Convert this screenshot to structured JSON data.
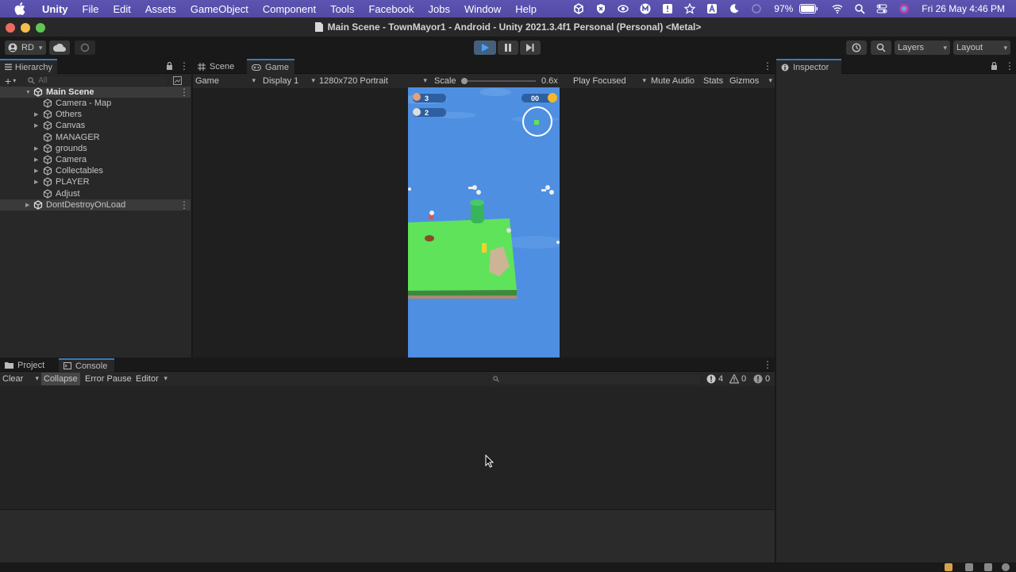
{
  "menubar": {
    "app": "Unity",
    "items": [
      "File",
      "Edit",
      "Assets",
      "GameObject",
      "Component",
      "Tools",
      "Facebook",
      "Jobs",
      "Window",
      "Help"
    ],
    "battery": "97%",
    "datetime": "Fri 26 May  4:46 PM",
    "status_icons": [
      "unity-icon",
      "x-shield-icon",
      "eye-icon",
      "m-icon",
      "alert-icon",
      "star-icon",
      "a-icon",
      "moon-icon",
      "wifi-dim-icon",
      "battery-icon",
      "wifi-icon",
      "search-icon",
      "control-center-icon",
      "siri-icon"
    ]
  },
  "window": {
    "title": "Main Scene - TownMayor1 - Android - Unity 2021.3.4f1 Personal (Personal) <Metal>"
  },
  "toolbar": {
    "account": "RD",
    "layers": "Layers",
    "layout": "Layout"
  },
  "hierarchy": {
    "tab": "Hierarchy",
    "search_placeholder": "All",
    "scene": "Main Scene",
    "items": [
      {
        "label": "Camera - Map",
        "arrow": false
      },
      {
        "label": "Others",
        "arrow": true
      },
      {
        "label": "Canvas",
        "arrow": true
      },
      {
        "label": "MANAGER",
        "arrow": false
      },
      {
        "label": "grounds",
        "arrow": true
      },
      {
        "label": "Camera",
        "arrow": true
      },
      {
        "label": "Collectables",
        "arrow": true
      },
      {
        "label": "PLAYER",
        "arrow": true
      },
      {
        "label": "Adjust",
        "arrow": false
      }
    ],
    "dontdestroy": "DontDestroyOnLoad"
  },
  "game_view": {
    "tabs": [
      "Scene",
      "Game"
    ],
    "mode": "Game",
    "display": "Display 1",
    "resolution": "1280x720 Portrait",
    "scale_label": "Scale",
    "scale_value": "0.6x",
    "play_focused": "Play Focused",
    "mute_audio": "Mute Audio",
    "stats": "Stats",
    "gizmos": "Gizmos",
    "hud": {
      "wood": "3",
      "stone": "2",
      "coins": "00"
    }
  },
  "inspector": {
    "tab": "Inspector"
  },
  "console": {
    "tabs": [
      "Project",
      "Console"
    ],
    "clear": "Clear",
    "collapse": "Collapse",
    "error_pause": "Error Pause",
    "editor": "Editor",
    "counts": {
      "info": "4",
      "warn": "0",
      "error": "0"
    }
  }
}
